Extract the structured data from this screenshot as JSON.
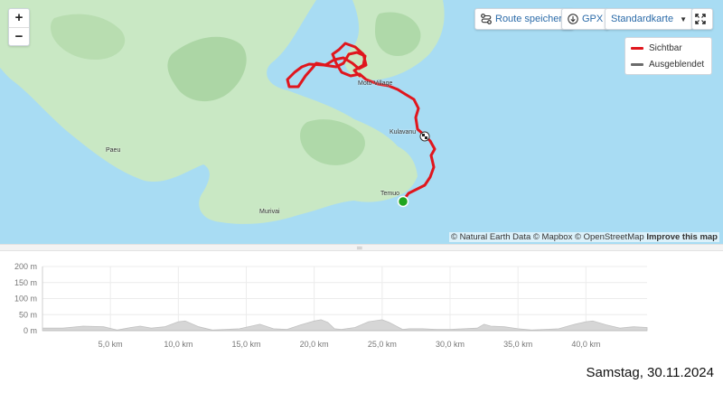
{
  "map": {
    "zoom_in": "+",
    "zoom_out": "−",
    "save_route_label": "Route speichern",
    "gpx_label": "GPX",
    "map_style_label": "Standardkarte",
    "legend": [
      {
        "label": "Sichtbar",
        "color": "#e0161d"
      },
      {
        "label": "Ausgeblendet",
        "color": "#6b6b6b"
      }
    ],
    "places": [
      "Moto Village",
      "Kulavanu",
      "Temuo",
      "Paeu",
      "Murivai"
    ],
    "attribution": "© Natural Earth Data © Mapbox © OpenStreetMap",
    "improve_link": "Improve this map",
    "colors": {
      "water": "#a8dcf3",
      "land": "#c9e8c4",
      "route": "#e0161d",
      "start": "#1fa51f"
    }
  },
  "chart_data": {
    "type": "area",
    "xlabel": "",
    "ylabel": "",
    "yticks": [
      "200 m",
      "150 m",
      "100 m",
      "50 m",
      "0 m"
    ],
    "ylim": [
      0,
      200
    ],
    "xticks": [
      "5,0 km",
      "10,0 km",
      "15,0 km",
      "20,0 km",
      "25,0 km",
      "30,0 km",
      "35,0 km",
      "40,0 km"
    ],
    "xlim": [
      0,
      44.5
    ],
    "x": [
      0,
      1.5,
      3,
      4.5,
      5.5,
      6.5,
      7.2,
      8,
      9,
      10,
      10.5,
      11.5,
      12.5,
      13.5,
      14.5,
      16,
      17,
      18,
      19,
      20,
      20.5,
      21,
      21.5,
      22,
      23,
      24,
      25,
      25.5,
      26.5,
      27,
      28,
      29,
      30,
      31,
      32,
      32.5,
      33,
      34,
      35,
      36,
      37,
      38,
      39,
      40,
      40.5,
      41.5,
      42.5,
      43.5,
      44.5
    ],
    "y": [
      8,
      8,
      14,
      12,
      2,
      10,
      14,
      8,
      12,
      28,
      30,
      12,
      2,
      4,
      6,
      20,
      6,
      4,
      18,
      30,
      34,
      26,
      6,
      4,
      10,
      28,
      34,
      26,
      4,
      6,
      6,
      4,
      4,
      6,
      8,
      20,
      14,
      12,
      6,
      2,
      4,
      6,
      18,
      28,
      30,
      18,
      8,
      12,
      10
    ]
  },
  "footer": {
    "date": "Samstag, 30.11.2024"
  }
}
